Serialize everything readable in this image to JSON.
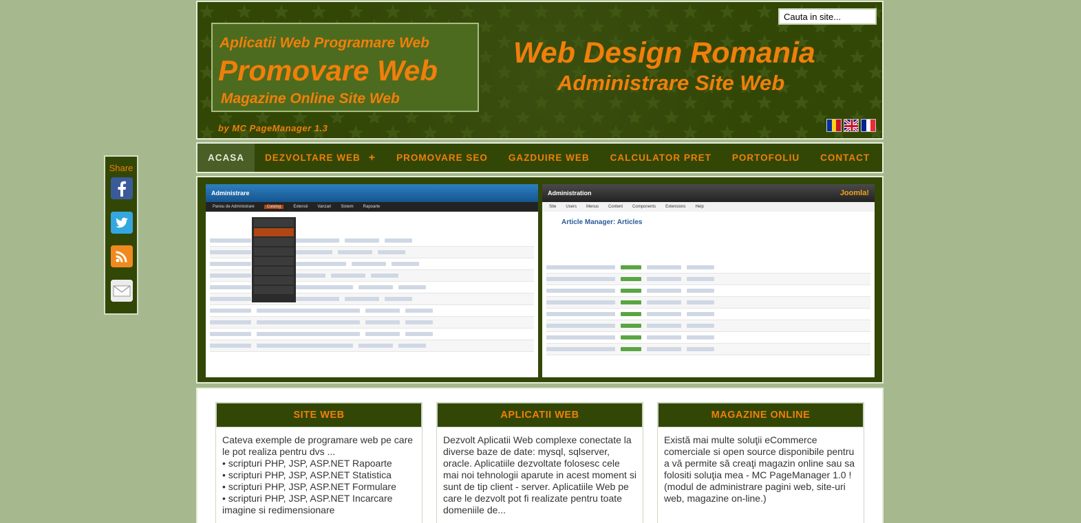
{
  "colors": {
    "page_bg": "#a5b88e",
    "header_bg": "#324706",
    "accent": "#f07f0b",
    "border": "#e7edd9"
  },
  "header": {
    "box_line1": "Aplicatii Web  Programare Web",
    "box_line2": "Promovare Web",
    "box_line3": "Magazine Online  Site Web",
    "byline": "by  MC PageManager  1.3",
    "brand_title": "Web Design Romania",
    "brand_subtitle": "Administrare Site Web",
    "search_value": "Cauta in site...",
    "flags": [
      "flag-ro-icon",
      "flag-uk-icon",
      "flag-fr-icon"
    ]
  },
  "nav": {
    "items": [
      {
        "label": "ACASA",
        "active": true
      },
      {
        "label": "DEZVOLTARE WEB",
        "has_submenu": true,
        "submenu_glyph": "+"
      },
      {
        "label": "PROMOVARE SEO"
      },
      {
        "label": "GAZDUIRE WEB"
      },
      {
        "label": "CALCULATOR PRET"
      },
      {
        "label": "PORTOFOLIU"
      },
      {
        "label": "CONTACT"
      }
    ]
  },
  "slider": {
    "shot_a_title": "Administrare",
    "shot_a_menu": [
      "Panou de Administrare",
      "Catalog",
      "Extensii",
      "Vanzari",
      "Sistem",
      "Rapoarte"
    ],
    "shot_b_title": "Administration",
    "shot_b_menu": [
      "Site",
      "Users",
      "Menus",
      "Content",
      "Components",
      "Extensions",
      "Help"
    ],
    "shot_b_heading": "Article Manager: Articles",
    "shot_b_logo": "Joomla!"
  },
  "boxes": [
    {
      "title": "SITE WEB",
      "text": "Cateva exemple de programare web pe care le pot realiza pentru dvs ...\n• scripturi PHP, JSP, ASP.NET Rapoarte\n• scripturi PHP, JSP, ASP.NET Statistica\n• scripturi PHP, JSP, ASP.NET Formulare\n• scripturi PHP, JSP, ASP.NET Incarcare imagine si redimensionare"
    },
    {
      "title": "APLICATII WEB",
      "text": "Dezvolt Aplicatii Web complexe conectate la diverse baze de date: mysql, sqlserver, oracle. Aplicatiile dezvoltate folosesc cele mai noi tehnologii aparute in acest moment si sunt de tip client - server. Aplicatiile Web pe care le dezvolt pot fi realizate pentru toate domeniile de..."
    },
    {
      "title": "MAGAZINE ONLINE",
      "text": "Există mai multe soluţii eCommerce comerciale si open source disponibile pentru a vă permite să creaţi magazin online sau sa folositi soluţia mea - MC PageManager 1.0 ! (modul de administrare pagini web, site-uri web, magazine on-line.)"
    }
  ],
  "share": {
    "label": "Share",
    "buttons": [
      "facebook-icon",
      "twitter-icon",
      "rss-icon",
      "email-icon"
    ]
  }
}
